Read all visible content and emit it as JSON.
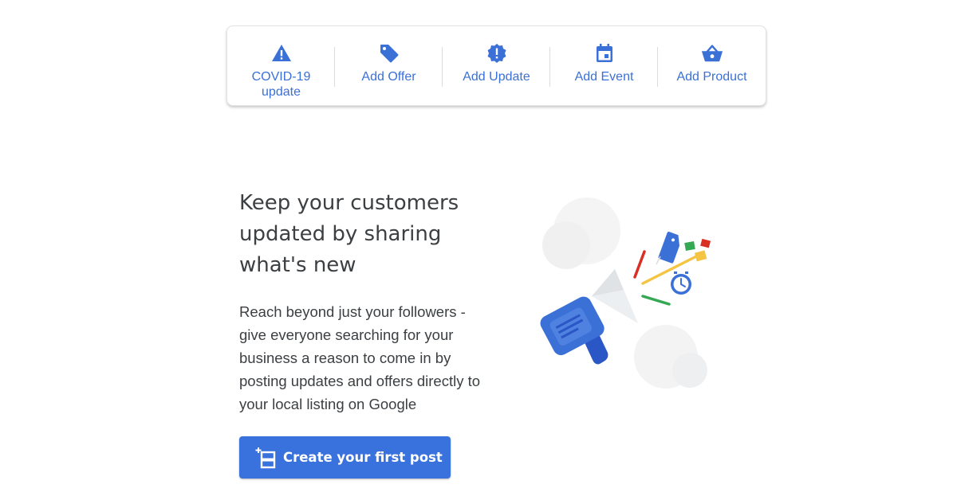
{
  "toolbar": {
    "items": [
      {
        "label": "COVID-19 update",
        "icon": "warning-icon"
      },
      {
        "label": "Add Offer",
        "icon": "tag-icon"
      },
      {
        "label": "Add Update",
        "icon": "alert-badge-icon"
      },
      {
        "label": "Add Event",
        "icon": "calendar-icon"
      },
      {
        "label": "Add Product",
        "icon": "basket-icon"
      }
    ]
  },
  "main": {
    "headline": "Keep your customers updated by sharing what's new",
    "body": "Reach beyond just your followers - give everyone searching for your business a reason to come in by posting updates and offers directly to your local listing on Google",
    "cta_label": "Create your first post",
    "cta_icon": "add-post-icon",
    "illustration": "megaphone-illustration"
  },
  "colors": {
    "accent": "#3a72dd",
    "label_blue": "#3b70d6",
    "text": "#3c4043"
  }
}
